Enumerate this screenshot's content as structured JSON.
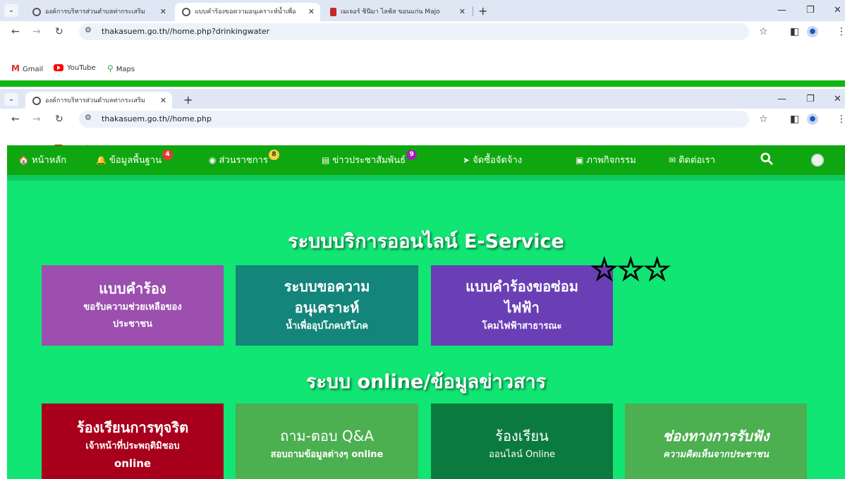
{
  "browser_top": {
    "tabs": [
      {
        "label": "องค์การบริหารส่วนตำบลท่ากระเสริม"
      },
      {
        "label": "แบบคำร้องขอความอนุเคราะห์น้ำเพื่อ"
      },
      {
        "label": "เมเจอร์ ซินีมา ไลฟ์ส ขอนแก่น Majo"
      }
    ],
    "url": "thakasuem.go.th//home.php?drinkingwater"
  },
  "browser_second": {
    "tabs": [
      {
        "label": "องค์การบริหารส่วนตำบลท่ากระเสริม"
      }
    ],
    "url": "thakasuem.go.th//home.php"
  },
  "bookmarks": [
    {
      "label": "Gmail",
      "icon": "gmail-icon"
    },
    {
      "label": "YouTube",
      "icon": "youtube-icon"
    },
    {
      "label": "Maps",
      "icon": "maps-icon"
    }
  ],
  "nav": {
    "items": [
      {
        "label": "หน้าหลัก",
        "icon": "home-icon",
        "glyph": "🏠"
      },
      {
        "label": "ข้อมูลพื้นฐาน",
        "icon": "bell-icon",
        "glyph": "🔔",
        "badge": "4"
      },
      {
        "label": "ส่วนราชการ",
        "icon": "user-circle-icon",
        "glyph": "◉",
        "badge": "8"
      },
      {
        "label": "ข่าวประชาสัมพันธ์",
        "icon": "newspaper-icon",
        "glyph": "▤",
        "badge": "9"
      },
      {
        "label": "จัดซื้อจัดจ้าง",
        "icon": "paper-plane-icon",
        "glyph": "➤"
      },
      {
        "label": "ภาพกิจกรรม",
        "icon": "image-icon",
        "glyph": "▣"
      },
      {
        "label": "ติดต่อเรา",
        "icon": "envelope-icon",
        "glyph": "✉"
      }
    ]
  },
  "content": {
    "heading1": "ระบบบริการออนไลน์ E-Service",
    "heading2": "ระบบ online/ข้อมูลข่าวสาร",
    "service_cards": [
      {
        "title": "แบบคำร้อง",
        "sub": "ขอรับความช่วยเหลือของ",
        "sub2": "ประชาชน",
        "color": "#9c4fae"
      },
      {
        "title": "ระบบขอความ",
        "title2": "อนุเคราะห์",
        "sub": "น้ำเพื่ออุปโภคบริโภค",
        "color": "#14857a"
      },
      {
        "title": "แบบคำร้องขอซ่อม",
        "title2": "ไฟฟ้า",
        "sub": "โคมไฟฟ้าสาธารณะ",
        "color": "#6a3fb5"
      }
    ],
    "stars": "☆☆☆",
    "info_cards": [
      {
        "title": "ร้องเรียนการทุจริต",
        "sub": "เจ้าหน้าที่ประพฤติมิชอบ",
        "sub2": "online",
        "color": "#a8001c"
      },
      {
        "title": "ถาม-ตอบ Q&A",
        "sub": "สอบถามข้อมูลต่างๆ online",
        "color": "#4caf50"
      },
      {
        "title": "ร้องเรียน",
        "sub": "ออนไลน์ Online",
        "color": "#0b7a3e"
      },
      {
        "title": "ช่องทางการรับฟัง",
        "sub": "ความคิดเห็นจากประชาชน",
        "color": "#4caf50"
      }
    ]
  }
}
